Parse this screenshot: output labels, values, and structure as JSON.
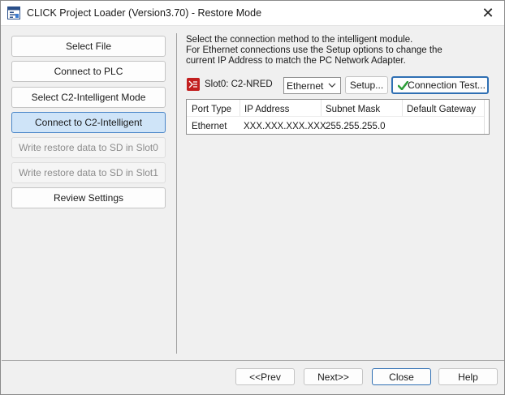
{
  "window": {
    "title": "CLICK Project Loader (Version3.70) - Restore Mode",
    "app_icon": "app-window-icon",
    "close_glyph": "✕"
  },
  "steps": [
    {
      "label": "Select File",
      "state": "normal"
    },
    {
      "label": "Connect to PLC",
      "state": "normal"
    },
    {
      "label": "Select C2-Intelligent Mode",
      "state": "normal"
    },
    {
      "label": "Connect to C2-Intelligent",
      "state": "active"
    },
    {
      "label": "Write restore data to SD in Slot0",
      "state": "disabled"
    },
    {
      "label": "Write restore data to SD in Slot1",
      "state": "disabled"
    },
    {
      "label": "Review Settings",
      "state": "normal"
    }
  ],
  "instructions": {
    "line1": "Select the connection method to the intelligent module.",
    "line2": "For Ethernet connections use the Setup options to change the",
    "line3": "current IP Address to match the PC Network Adapter."
  },
  "slot": {
    "label": "Slot0: C2-NRED",
    "connection_type": "Ethernet",
    "setup_label": "Setup...",
    "test_label": "Connection Test..."
  },
  "table": {
    "headers": [
      "Port Type",
      "IP Address",
      "Subnet Mask",
      "Default Gateway"
    ],
    "rows": [
      [
        "Ethernet",
        "XXX.XXX.XXX.XXX",
        "255.255.255.0",
        ""
      ]
    ]
  },
  "footer": {
    "prev_label": "<<Prev",
    "next_label": "Next>>",
    "close_label": "Close",
    "help_label": "Help"
  },
  "colors": {
    "active_step_bg": "#cfe4f8",
    "active_step_border": "#4a86c8",
    "slot_icon": "#c21f1f",
    "check": "#2e9e3a"
  }
}
